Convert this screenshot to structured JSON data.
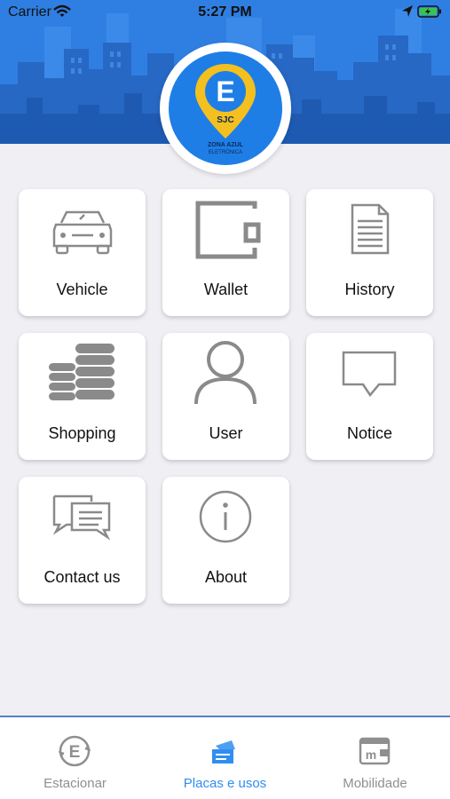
{
  "status_bar": {
    "carrier": "Carrier",
    "time": "5:27 PM"
  },
  "logo": {
    "letter": "E",
    "city": "SJC",
    "line1": "ZONA AZUL",
    "line2": "ELETRÔNICA"
  },
  "menu": [
    {
      "label": "Vehicle",
      "icon": "car-icon"
    },
    {
      "label": "Wallet",
      "icon": "wallet-icon"
    },
    {
      "label": "History",
      "icon": "document-icon"
    },
    {
      "label": "Shopping",
      "icon": "coins-icon"
    },
    {
      "label": "User",
      "icon": "user-icon"
    },
    {
      "label": "Notice",
      "icon": "speech-bubble-icon"
    },
    {
      "label": "Contact us",
      "icon": "chat-bubbles-icon"
    },
    {
      "label": "About",
      "icon": "info-icon"
    }
  ],
  "tabs": [
    {
      "label": "Estacionar",
      "icon": "parking-e-icon",
      "active": false
    },
    {
      "label": "Placas e usos",
      "icon": "tickets-icon",
      "active": true
    },
    {
      "label": "Mobilidade",
      "icon": "mobility-card-icon",
      "active": false
    }
  ],
  "colors": {
    "header": "#2f7fe3",
    "accent": "#2f8ef0",
    "logo_pin": "#f4c020",
    "icon_gray": "#8a8a8a"
  }
}
